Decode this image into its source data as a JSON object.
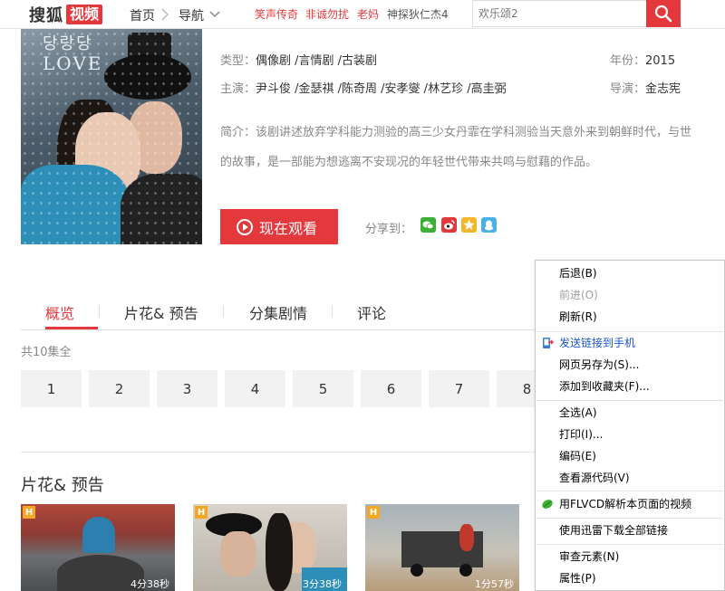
{
  "header": {
    "logo_text": "搜狐",
    "logo_badge": "视频",
    "nav_home": "首页",
    "nav_guide": "导航",
    "hot_links": [
      "笑声传奇",
      "非诚勿扰",
      "老妈",
      "神探狄仁杰4"
    ],
    "hot_colors": [
      "#e4393c",
      "#e4393c",
      "#e4393c",
      "#555555"
    ],
    "search_placeholder": "欢乐颂2"
  },
  "poster": {
    "title_art": "LOVE",
    "title_art_top": "당랑당"
  },
  "details": {
    "genre_label": "类型：",
    "genres": "偶像剧 /言情剧 /古装剧",
    "year_label": "年份：",
    "year": "2015",
    "cast_label": "主演：",
    "cast": "尹斗俊 /金瑟祺 /陈奇周 /安孝燮 /林艺珍 /高圭弼",
    "director_label": "导演：",
    "director": "金志宪",
    "synopsis_line1": "简介：该剧讲述放弃学科能力测验的高三少女丹霏在学科测验当天意外来到朝鲜时代，与世",
    "synopsis_line2": "的故事，是一部能为想逃离不安现况的年轻世代带来共鸣与慰藉的作品。"
  },
  "actions": {
    "watch_now": "现在观看",
    "share_label": "分享到："
  },
  "tabs": [
    "概览",
    "片花& 预告",
    "分集剧情",
    "评论"
  ],
  "episodes": {
    "count_label": "共10集全",
    "numbers": [
      "1",
      "2",
      "3",
      "4",
      "5",
      "6",
      "7",
      "8"
    ]
  },
  "clips": {
    "section_title": "片花& 预告",
    "badge": "H",
    "durations": [
      "4分38秒",
      "3分38秒",
      "1分57秒"
    ]
  },
  "context_menu": {
    "back": "后退(B)",
    "forward": "前进(O)",
    "refresh": "刷新(R)",
    "send_to_phone": "发送链接到手机",
    "save_as": "网页另存为(S)...",
    "add_favorite": "添加到收藏夹(F)...",
    "select_all": "全选(A)",
    "print": "打印(I)...",
    "encoding": "编码(E)",
    "view_source": "查看源代码(V)",
    "flvcd": "用FLVCD解析本页面的视频",
    "thunder": "使用迅雷下载全部链接",
    "inspect": "审查元素(N)",
    "properties": "属性(P)"
  }
}
